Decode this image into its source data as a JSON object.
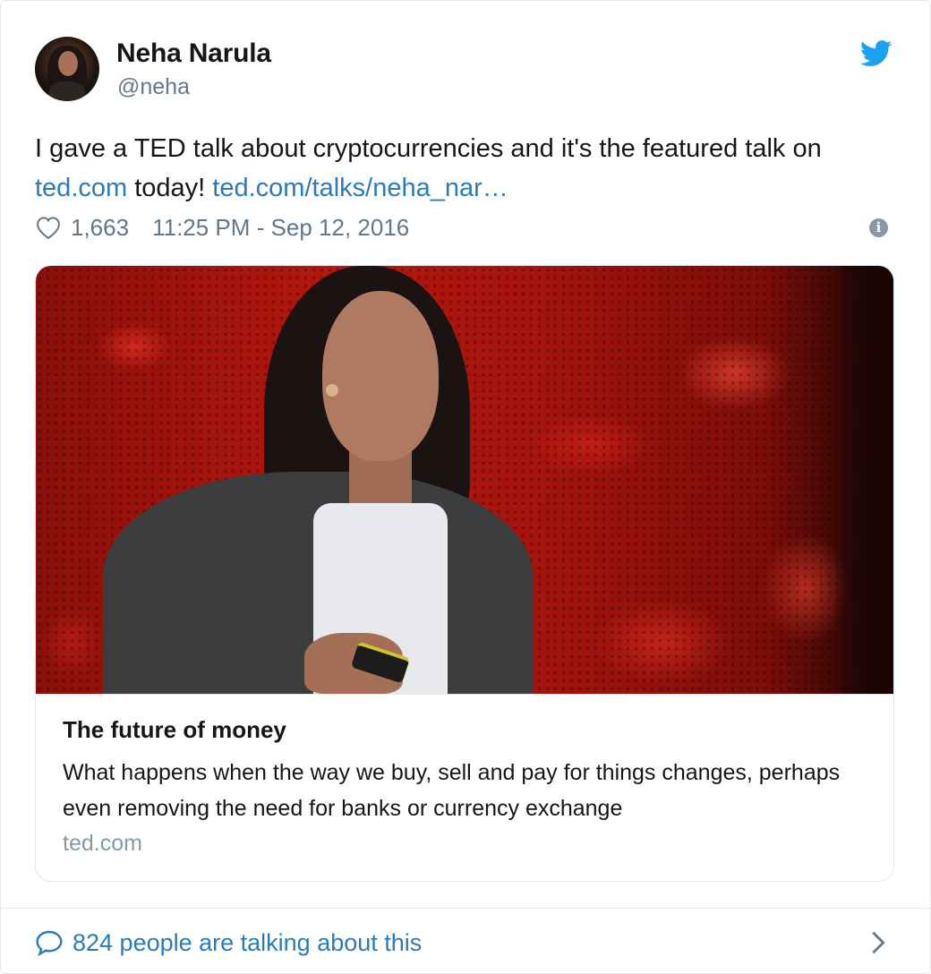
{
  "author": {
    "display_name": "Neha Narula",
    "handle": "@neha"
  },
  "tweet": {
    "text_before": "I gave a TED talk about cryptocurrencies and it's the featured talk on ",
    "link1": "ted.com",
    "text_middle": " today! ",
    "link2": "ted.com/talks/neha_nar…"
  },
  "meta": {
    "like_count": "1,663",
    "timestamp": "11:25 PM - Sep 12, 2016"
  },
  "card": {
    "title": "The future of money",
    "description": "What happens when the way we buy, sell and pay for things changes, perhaps even removing the need for banks or currency exchange",
    "domain": "ted.com"
  },
  "footer": {
    "talking_text": "824 people are talking about this"
  },
  "icons": {
    "brand": "twitter-bird-icon",
    "like": "heart-icon",
    "info": "info-icon",
    "reply": "speech-bubble-icon",
    "more": "chevron-right-icon"
  },
  "colors": {
    "link": "#2b7bb9",
    "twitter_blue": "#1da1f2",
    "muted": "#657786",
    "border": "#e1e8ed"
  }
}
